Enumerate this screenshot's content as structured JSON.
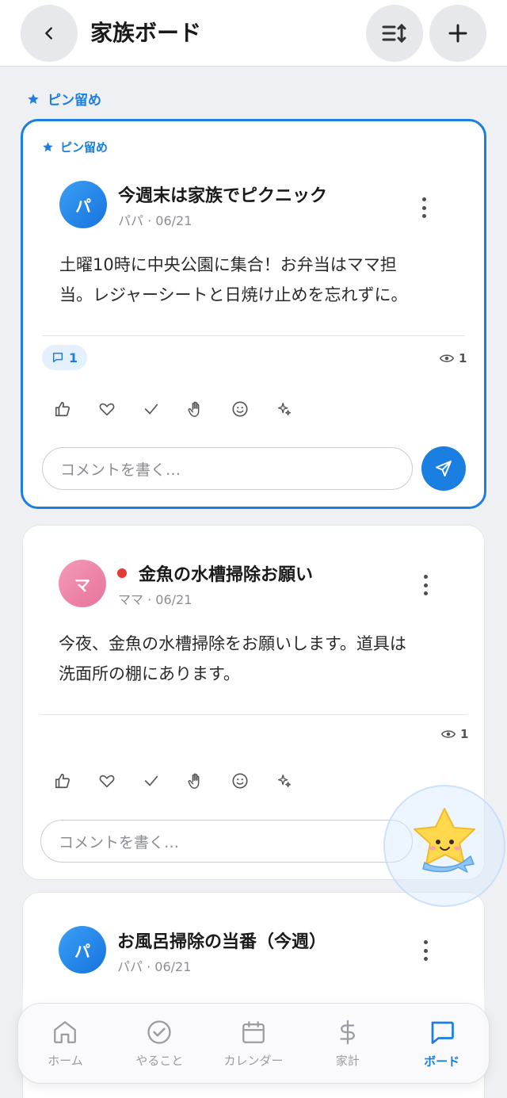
{
  "header": {
    "title": "家族ボード"
  },
  "pinned_section": {
    "label": "ピン留め"
  },
  "posts": [
    {
      "pin_label": "ピン留め",
      "avatar": "パ",
      "title": "今週末は家族でピクニック",
      "meta": "パパ · 06/21",
      "body_line1": "土曜10時に中央公園に集合！お弁当はママ担",
      "body_line2": "当。レジャーシートと日焼け止めを忘れずに。",
      "comment_count": "1",
      "views": "1",
      "comment_placeholder": "コメントを書く…"
    },
    {
      "avatar": "マ",
      "title": "金魚の水槽掃除お願い",
      "meta": "ママ · 06/21",
      "body_line1": "今夜、金魚の水槽掃除をお願いします。道具は",
      "body_line2": "洗面所の棚にあります。",
      "views": "1",
      "comment_placeholder": "コメントを書く…"
    },
    {
      "avatar": "パ",
      "title": "お風呂掃除の当番（今週）",
      "meta": "パパ · 06/21"
    }
  ],
  "nav": {
    "items": [
      {
        "label": "ホーム",
        "icon": "home-icon"
      },
      {
        "label": "やること",
        "icon": "check-circle-icon"
      },
      {
        "label": "カレンダー",
        "icon": "calendar-icon"
      },
      {
        "label": "家計",
        "icon": "dollar-icon"
      },
      {
        "label": "ボード",
        "icon": "chat-icon"
      }
    ],
    "active": "ボード"
  },
  "colors": {
    "accent": "#1a7fe0",
    "status_red": "#e53935"
  }
}
